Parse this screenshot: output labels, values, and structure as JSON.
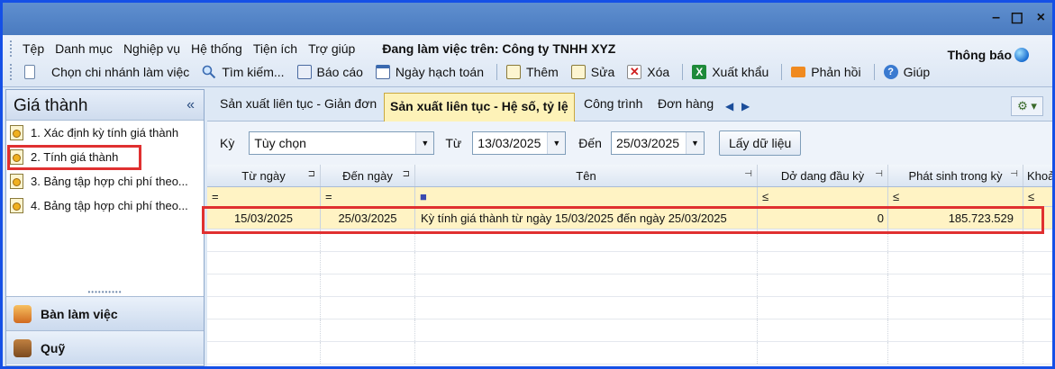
{
  "window_controls": {
    "minimize": "–",
    "maximize": "☐",
    "close": "×"
  },
  "menu": {
    "items": [
      "Tệp",
      "Danh mục",
      "Nghiệp vụ",
      "Hệ thống",
      "Tiện ích",
      "Trợ giúp"
    ],
    "working_on": "Đang làm việc trên: Công ty TNHH XYZ",
    "notification": "Thông báo"
  },
  "toolbar": {
    "items": [
      {
        "label": "Chọn chi nhánh làm việc",
        "icon": "branch-icon"
      },
      {
        "label": "Tìm kiếm...",
        "icon": "search-icon"
      },
      {
        "label": "Báo cáo",
        "icon": "report-icon"
      },
      {
        "label": "Ngày hạch toán",
        "icon": "calendar-icon"
      },
      {
        "label": "Thêm",
        "icon": "add-icon"
      },
      {
        "label": "Sửa",
        "icon": "edit-icon"
      },
      {
        "label": "Xóa",
        "icon": "delete-icon"
      },
      {
        "label": "Xuất khẩu",
        "icon": "excel-icon"
      },
      {
        "label": "Phản hồi",
        "icon": "mail-icon"
      },
      {
        "label": "Giúp",
        "icon": "help-icon"
      }
    ]
  },
  "sidebar": {
    "title": "Giá thành",
    "collapse": "«",
    "items": [
      {
        "label": "1. Xác định kỳ tính giá thành"
      },
      {
        "label": "2. Tính giá thành"
      },
      {
        "label": "3. Bảng tập hợp chi phí theo..."
      },
      {
        "label": "4. Bảng tập hợp chi phí theo..."
      }
    ],
    "splitter": "••••••••••",
    "nav": [
      {
        "label": "Bàn làm việc"
      },
      {
        "label": "Quỹ"
      }
    ]
  },
  "tabs": {
    "items": [
      "Sản xuất liên tục - Giản đơn",
      "Sản xuất liên tục - Hệ số, tỷ lệ",
      "Công trình",
      "Đơn hàng"
    ],
    "active": 1,
    "prev": "◀",
    "next": "▶",
    "gear": "⚙ ▾"
  },
  "filter": {
    "period_label": "Kỳ",
    "period_value": "Tùy chọn",
    "from_label": "Từ",
    "from_value": "13/03/2025",
    "to_label": "Đến",
    "to_value": "25/03/2025",
    "fetch_button": "Lấy dữ liệu"
  },
  "grid": {
    "columns": [
      "Từ ngày",
      "Đến ngày",
      "Tên",
      "Dở dang đầu kỳ",
      "Phát sinh trong kỳ",
      "Khoả"
    ],
    "filter_ops": [
      "=",
      "=",
      "■",
      "≤",
      "≤",
      "≤"
    ],
    "rows": [
      {
        "from": "15/03/2025",
        "to": "25/03/2025",
        "name": "Kỳ tính giá thành từ ngày 15/03/2025 đến ngày 25/03/2025",
        "opening_wip": "0",
        "incurred": "185.723.529",
        "extra": ""
      }
    ]
  },
  "colors": {
    "highlight": "#e03030",
    "active_tab": "#fdf2b8",
    "selected_row": "#fff3c4"
  }
}
